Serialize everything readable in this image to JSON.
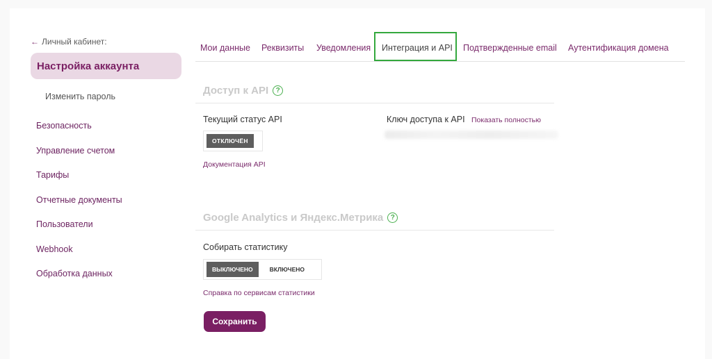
{
  "sidebar": {
    "back_label": "Личный кабинет:",
    "active_item": "Настройка аккаунта",
    "sub_item": "Изменить пароль",
    "items": [
      {
        "label": "Безопасность"
      },
      {
        "label": "Управление счетом"
      },
      {
        "label": "Тарифы"
      },
      {
        "label": "Отчетные документы"
      },
      {
        "label": "Пользователи"
      },
      {
        "label": "Webhook"
      },
      {
        "label": "Обработка данных"
      }
    ]
  },
  "tabs": [
    {
      "label": "Мои данные"
    },
    {
      "label": "Реквизиты"
    },
    {
      "label": "Уведомления"
    },
    {
      "label": "Интеграция и API",
      "highlighted": true
    },
    {
      "label": "Подтвержденные email"
    },
    {
      "label": "Аутентификация домена"
    }
  ],
  "api": {
    "title": "Доступ к API",
    "status_label": "Текущий статус API",
    "status_value": "ОТКЛЮЧЁН",
    "docs_link": "Документация API",
    "key_label": "Ключ доступа к API",
    "show_full_link": "Показать полностью"
  },
  "analytics": {
    "title": "Google Analytics и Яндекс.Метрика",
    "collect_label": "Собирать статистику",
    "toggle_off": "ВЫКЛЮЧЕНО",
    "toggle_on": "ВКЛЮЧЕНО",
    "help_link": "Справка по сервисам статистики"
  },
  "save_label": "Сохранить",
  "colors": {
    "accent": "#7a1f63",
    "highlight_border": "#33a83d",
    "active_bg": "#ead8e4"
  }
}
